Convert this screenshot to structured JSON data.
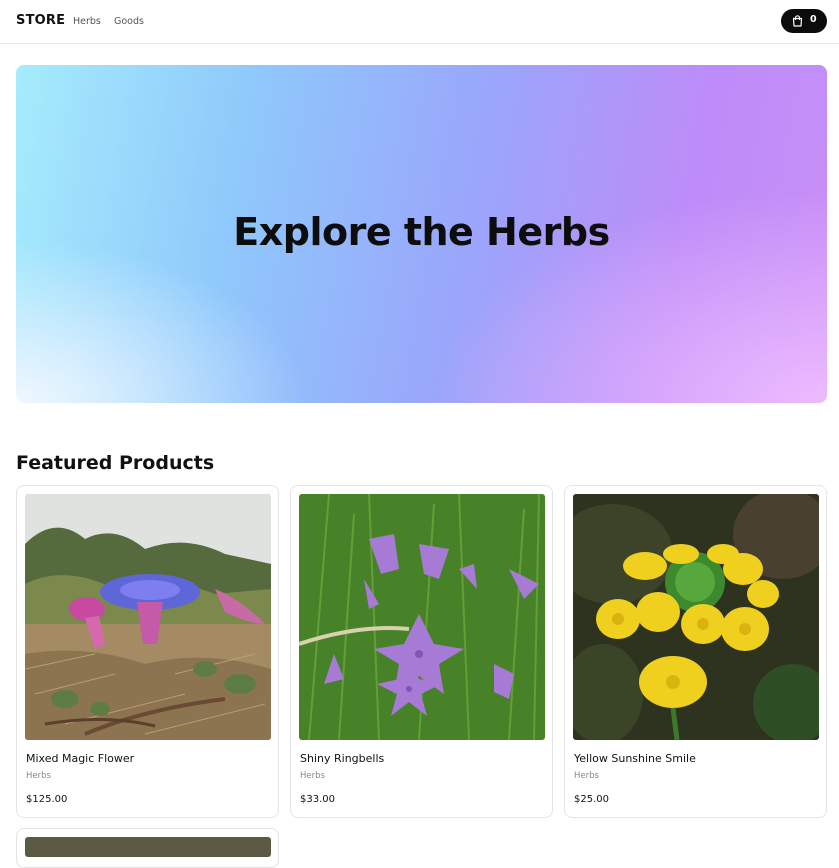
{
  "header": {
    "brand": "STORE",
    "nav": [
      {
        "label": "Herbs"
      },
      {
        "label": "Goods"
      }
    ],
    "cart": {
      "icon": "shopping-bag-icon",
      "count": "0"
    }
  },
  "hero": {
    "title": "Explore the Herbs"
  },
  "featured": {
    "title": "Featured Products",
    "products": [
      {
        "name": "Mixed Magic Flower",
        "category": "Herbs",
        "price": "$125.00"
      },
      {
        "name": "Shiny Ringbells",
        "category": "Herbs",
        "price": "$33.00"
      },
      {
        "name": "Yellow Sunshine Smile",
        "category": "Herbs",
        "price": "$25.00"
      }
    ]
  },
  "colors": {
    "accent": "#0c0c0c",
    "hero_gradient_start": "#a6ecfc",
    "hero_gradient_end": "#c88ff7"
  }
}
